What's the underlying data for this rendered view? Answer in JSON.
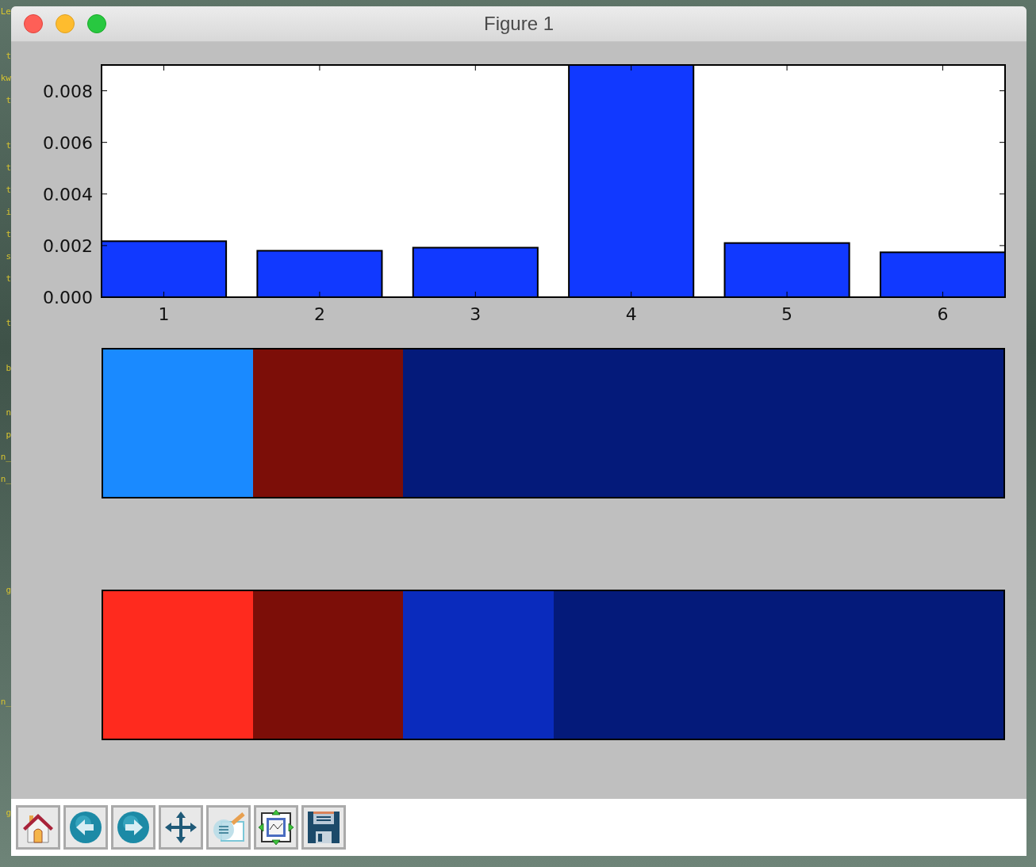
{
  "background_text": [
    "Le",
    "t",
    "kw",
    "t",
    "t",
    "t",
    "t",
    "i",
    "t",
    "s",
    "t",
    "t",
    "b",
    "n",
    "p",
    "n_",
    "n_",
    "g",
    "n_",
    "g"
  ],
  "window": {
    "title": "Figure 1"
  },
  "figure": {
    "chart_data": {
      "type": "bar",
      "categories": [
        "1",
        "2",
        "3",
        "4",
        "5",
        "6"
      ],
      "series": [
        {
          "color": "#1139ff",
          "values": [
            0.00217,
            0.0018,
            0.00192,
            0.009,
            0.0021,
            0.00174
          ]
        }
      ],
      "ylim": [
        0,
        0.009
      ],
      "yticks": [
        {
          "value": 0,
          "label": "0.000"
        },
        {
          "value": 0.002,
          "label": "0.002"
        },
        {
          "value": 0.004,
          "label": "0.004"
        },
        {
          "value": 0.006,
          "label": "0.006"
        },
        {
          "value": 0.008,
          "label": "0.008"
        }
      ]
    },
    "strips": [
      {
        "cells": [
          {
            "color": "#1a8aff"
          },
          {
            "color": "#7c0e08"
          },
          {
            "color": "#041a7a"
          },
          {
            "color": "#041a7a"
          },
          {
            "color": "#041a7a"
          },
          {
            "color": "#041a7a"
          }
        ]
      },
      {
        "cells": [
          {
            "color": "#ff2a1e"
          },
          {
            "color": "#7c0e08"
          },
          {
            "color": "#0a2bbd"
          },
          {
            "color": "#041a7a"
          },
          {
            "color": "#041a7a"
          },
          {
            "color": "#041a7a"
          }
        ]
      }
    ]
  },
  "toolbar": [
    {
      "kind": "home"
    },
    {
      "kind": "back"
    },
    {
      "kind": "forward"
    },
    {
      "kind": "pan"
    },
    {
      "kind": "zoom"
    },
    {
      "kind": "subplots"
    },
    {
      "kind": "save"
    }
  ]
}
